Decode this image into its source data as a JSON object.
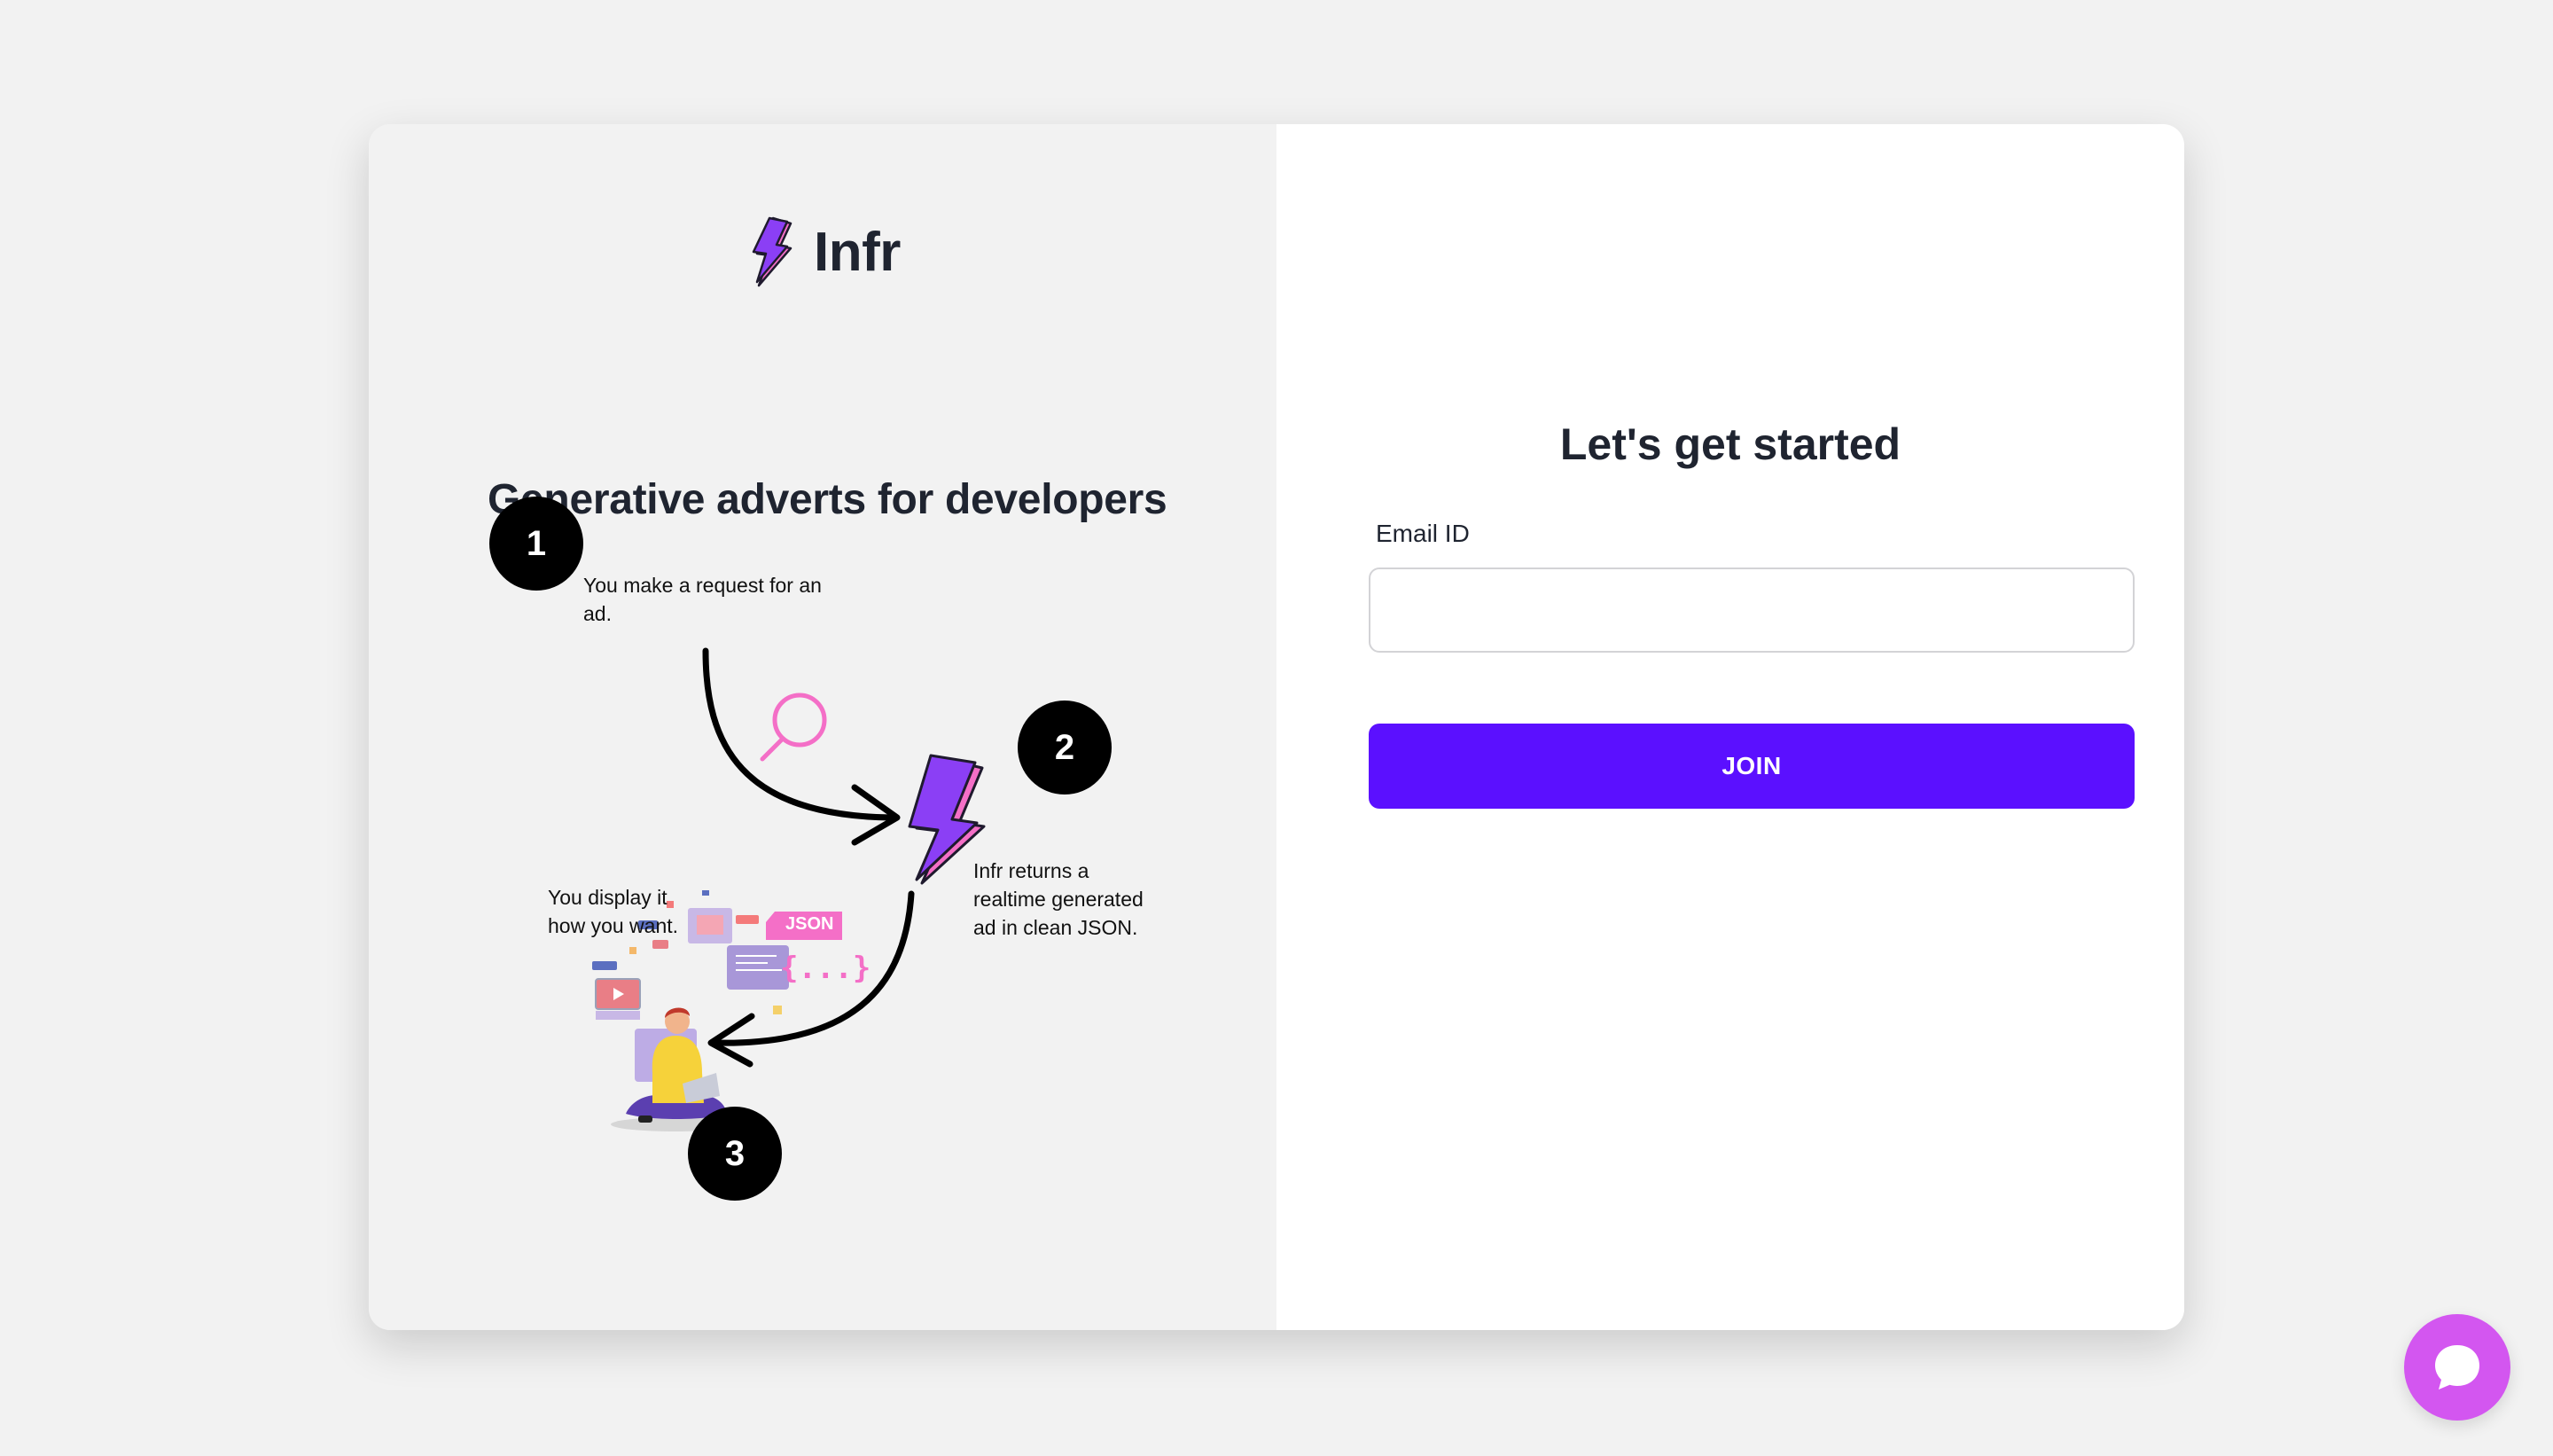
{
  "brand": {
    "name": "Infr",
    "tagline": "Generative adverts for developers",
    "logo_icon": "lightning-bolt-icon",
    "colors": {
      "purple": "#8b3ff5",
      "pink": "#f46fc7",
      "outline": "#1f1a2e"
    }
  },
  "steps": [
    {
      "number": "1",
      "text": "You make a request for an ad."
    },
    {
      "number": "2",
      "text": "Infr returns a realtime generated ad in clean JSON."
    },
    {
      "number": "3",
      "text": "You display it how you want."
    }
  ],
  "illustration": {
    "json_tag": "JSON",
    "json_braces": "{...}",
    "search_icon": "magnifier-icon",
    "person_icon": "developer-with-laptop-icon"
  },
  "form": {
    "title": "Let's get started",
    "email_label": "Email ID",
    "email_value": "",
    "email_placeholder": "",
    "join_label": "JOIN",
    "accent_color": "#5b10ff"
  },
  "chat": {
    "icon": "chat-bubble-icon",
    "color": "#d356f0"
  }
}
